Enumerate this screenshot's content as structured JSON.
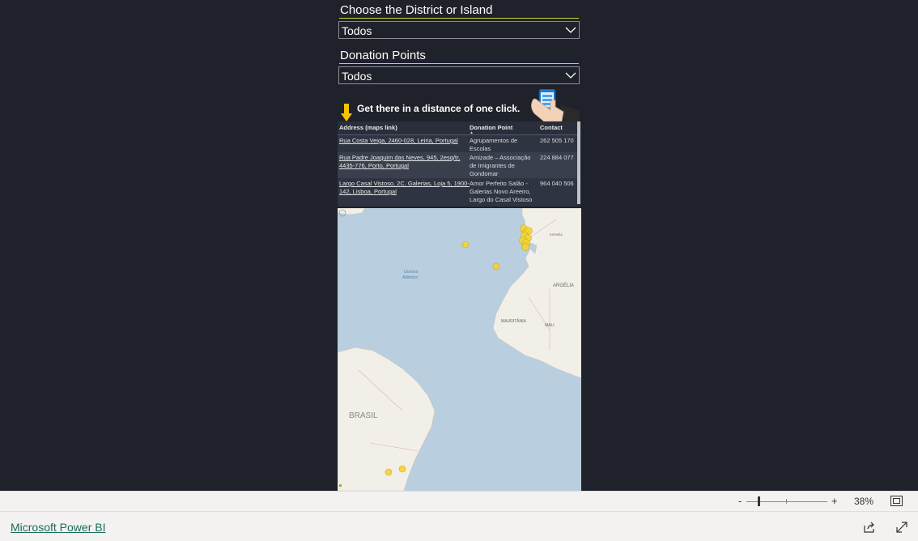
{
  "slicers": [
    {
      "title": "Choose the District or Island",
      "value": "Todos"
    },
    {
      "title": "Donation Points",
      "value": "Todos"
    }
  ],
  "banner": {
    "text": "Get there in a distance of one click."
  },
  "table": {
    "columns": [
      "Address (maps link)",
      "Donation Point",
      "Contact"
    ],
    "rows": [
      {
        "address": [
          "Rua Costa Veiga, 2460-028, Leiria, Portugal"
        ],
        "point": [
          "Agrupamentos de",
          "Escolas"
        ],
        "contact": "262 505 170"
      },
      {
        "address": [
          "Rua Padre Joaquim das Neves, 945, 2esq/tr,",
          "4435-776, Porto, Portugal"
        ],
        "point": [
          "Amizade – Associação",
          "de Imigrantes de",
          "Gondomar"
        ],
        "contact": "224 884 077"
      },
      {
        "address": [
          "Largo Casal Vistoso, 2C, Galerias, Loja 5, 1900-",
          "142, Lisboa, Portugal"
        ],
        "point": [
          "Amor Perfeito Salão -",
          "Galerias Novo Areeiro,",
          "Largo do Casal Vistoso"
        ],
        "contact": "964 040 506"
      }
    ]
  },
  "map": {
    "labels": {
      "ocean": [
        "Oceano",
        "Atlântico"
      ],
      "algeria": "ARGÉLIA",
      "mauritania": "MAURITÂNIA",
      "mali": "MALI",
      "brazil": "BRASIL",
      "spain": "ESPAÑA"
    },
    "colors": {
      "water": "#b9cfe0",
      "land": "#f2efe9",
      "marker": "#f2d437",
      "marker_stroke": "#c9a512"
    }
  },
  "zoom": {
    "minus": "-",
    "plus": "+",
    "percent": "38%"
  },
  "footer": {
    "brand": "Microsoft Power BI"
  },
  "icons": {
    "dropdown": "chevron-down-icon",
    "arrow": "down-arrow-icon",
    "phone": "phone-hand-icon",
    "fit": "fit-to-page-icon",
    "share": "share-icon",
    "expand": "expand-icon"
  }
}
